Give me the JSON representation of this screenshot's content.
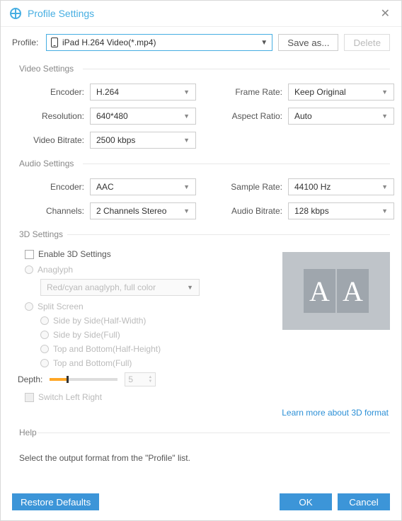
{
  "window": {
    "title": "Profile Settings"
  },
  "profile": {
    "label": "Profile:",
    "value": "iPad H.264 Video(*.mp4)",
    "save_as": "Save as...",
    "delete": "Delete"
  },
  "video": {
    "section": "Video Settings",
    "encoder_label": "Encoder:",
    "encoder": "H.264",
    "resolution_label": "Resolution:",
    "resolution": "640*480",
    "bitrate_label": "Video Bitrate:",
    "bitrate": "2500 kbps",
    "framerate_label": "Frame Rate:",
    "framerate": "Keep Original",
    "aspect_label": "Aspect Ratio:",
    "aspect": "Auto"
  },
  "audio": {
    "section": "Audio Settings",
    "encoder_label": "Encoder:",
    "encoder": "AAC",
    "channels_label": "Channels:",
    "channels": "2 Channels Stereo",
    "samplerate_label": "Sample Rate:",
    "samplerate": "44100 Hz",
    "bitrate_label": "Audio Bitrate:",
    "bitrate": "128 kbps"
  },
  "threeD": {
    "section": "3D Settings",
    "enable": "Enable 3D Settings",
    "anaglyph": "Anaglyph",
    "anaglyph_option": "Red/cyan anaglyph, full color",
    "split": "Split Screen",
    "sbs_half": "Side by Side(Half-Width)",
    "sbs_full": "Side by Side(Full)",
    "tab_half": "Top and Bottom(Half-Height)",
    "tab_full": "Top and Bottom(Full)",
    "depth_label": "Depth:",
    "depth_value": "5",
    "switch": "Switch Left Right",
    "learn_more": "Learn more about 3D format",
    "preview_glyph": "A"
  },
  "help": {
    "section": "Help",
    "text": "Select the output format from the \"Profile\" list."
  },
  "footer": {
    "restore": "Restore Defaults",
    "ok": "OK",
    "cancel": "Cancel"
  }
}
